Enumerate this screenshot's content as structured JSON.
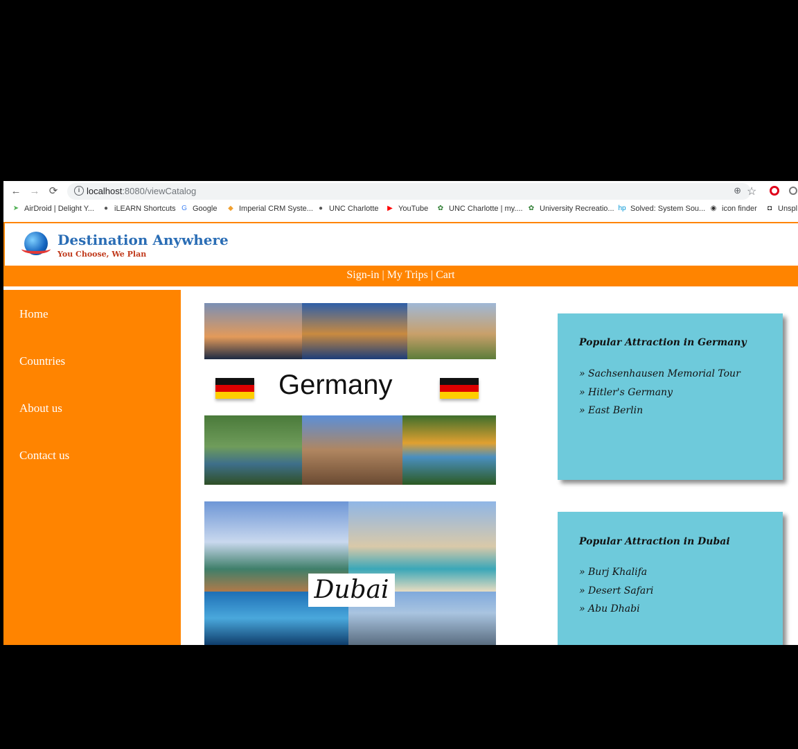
{
  "browser": {
    "url_host": "localhost",
    "url_path": ":8080/viewCatalog",
    "bookmarks": [
      {
        "label": "AirDroid | Delight Y...",
        "icon": "airdroid-icon",
        "color": "#4caf50"
      },
      {
        "label": "iLEARN Shortcuts",
        "icon": "globe-icon",
        "color": "#555555"
      },
      {
        "label": "Google",
        "icon": "google-icon",
        "color": "#4285f4"
      },
      {
        "label": "Imperial CRM Syste...",
        "icon": "crm-icon",
        "color": "#f0a030"
      },
      {
        "label": "UNC Charlotte",
        "icon": "globe-icon",
        "color": "#555555"
      },
      {
        "label": "YouTube",
        "icon": "youtube-icon",
        "color": "#ff0000"
      },
      {
        "label": "UNC Charlotte | my....",
        "icon": "unc-icon",
        "color": "#2e7d32"
      },
      {
        "label": "University Recreatio...",
        "icon": "unc-icon",
        "color": "#2e7d32"
      },
      {
        "label": "Solved: System Sou...",
        "icon": "hp-icon",
        "color": "#0096d6"
      },
      {
        "label": "icon finder",
        "icon": "iconfinder-icon",
        "color": "#333333"
      },
      {
        "label": "Unspl",
        "icon": "camera-icon",
        "color": "#111111"
      }
    ]
  },
  "site": {
    "logo_title": "Destination Anywhere",
    "logo_tagline": "You Choose, We Plan",
    "topnav": {
      "signin": "Sign-in",
      "trips": "My Trips",
      "cart": "Cart",
      "separator": "|"
    },
    "sidebar": [
      "Home",
      "Countries",
      "About us",
      "Contact us"
    ],
    "accent_color": "#ff8400",
    "card_color": "#6ecadb"
  },
  "catalog": [
    {
      "country": "Germany",
      "card_title": "Popular Attraction in Germany",
      "attractions": [
        "Sachsenhausen Memorial Tour",
        "Hitler's Germany",
        "East Berlin"
      ]
    },
    {
      "country": "Dubai",
      "card_title": "Popular Attraction in Dubai",
      "attractions": [
        "Burj Khalifa",
        "Desert Safari",
        "Abu Dhabi"
      ]
    }
  ]
}
